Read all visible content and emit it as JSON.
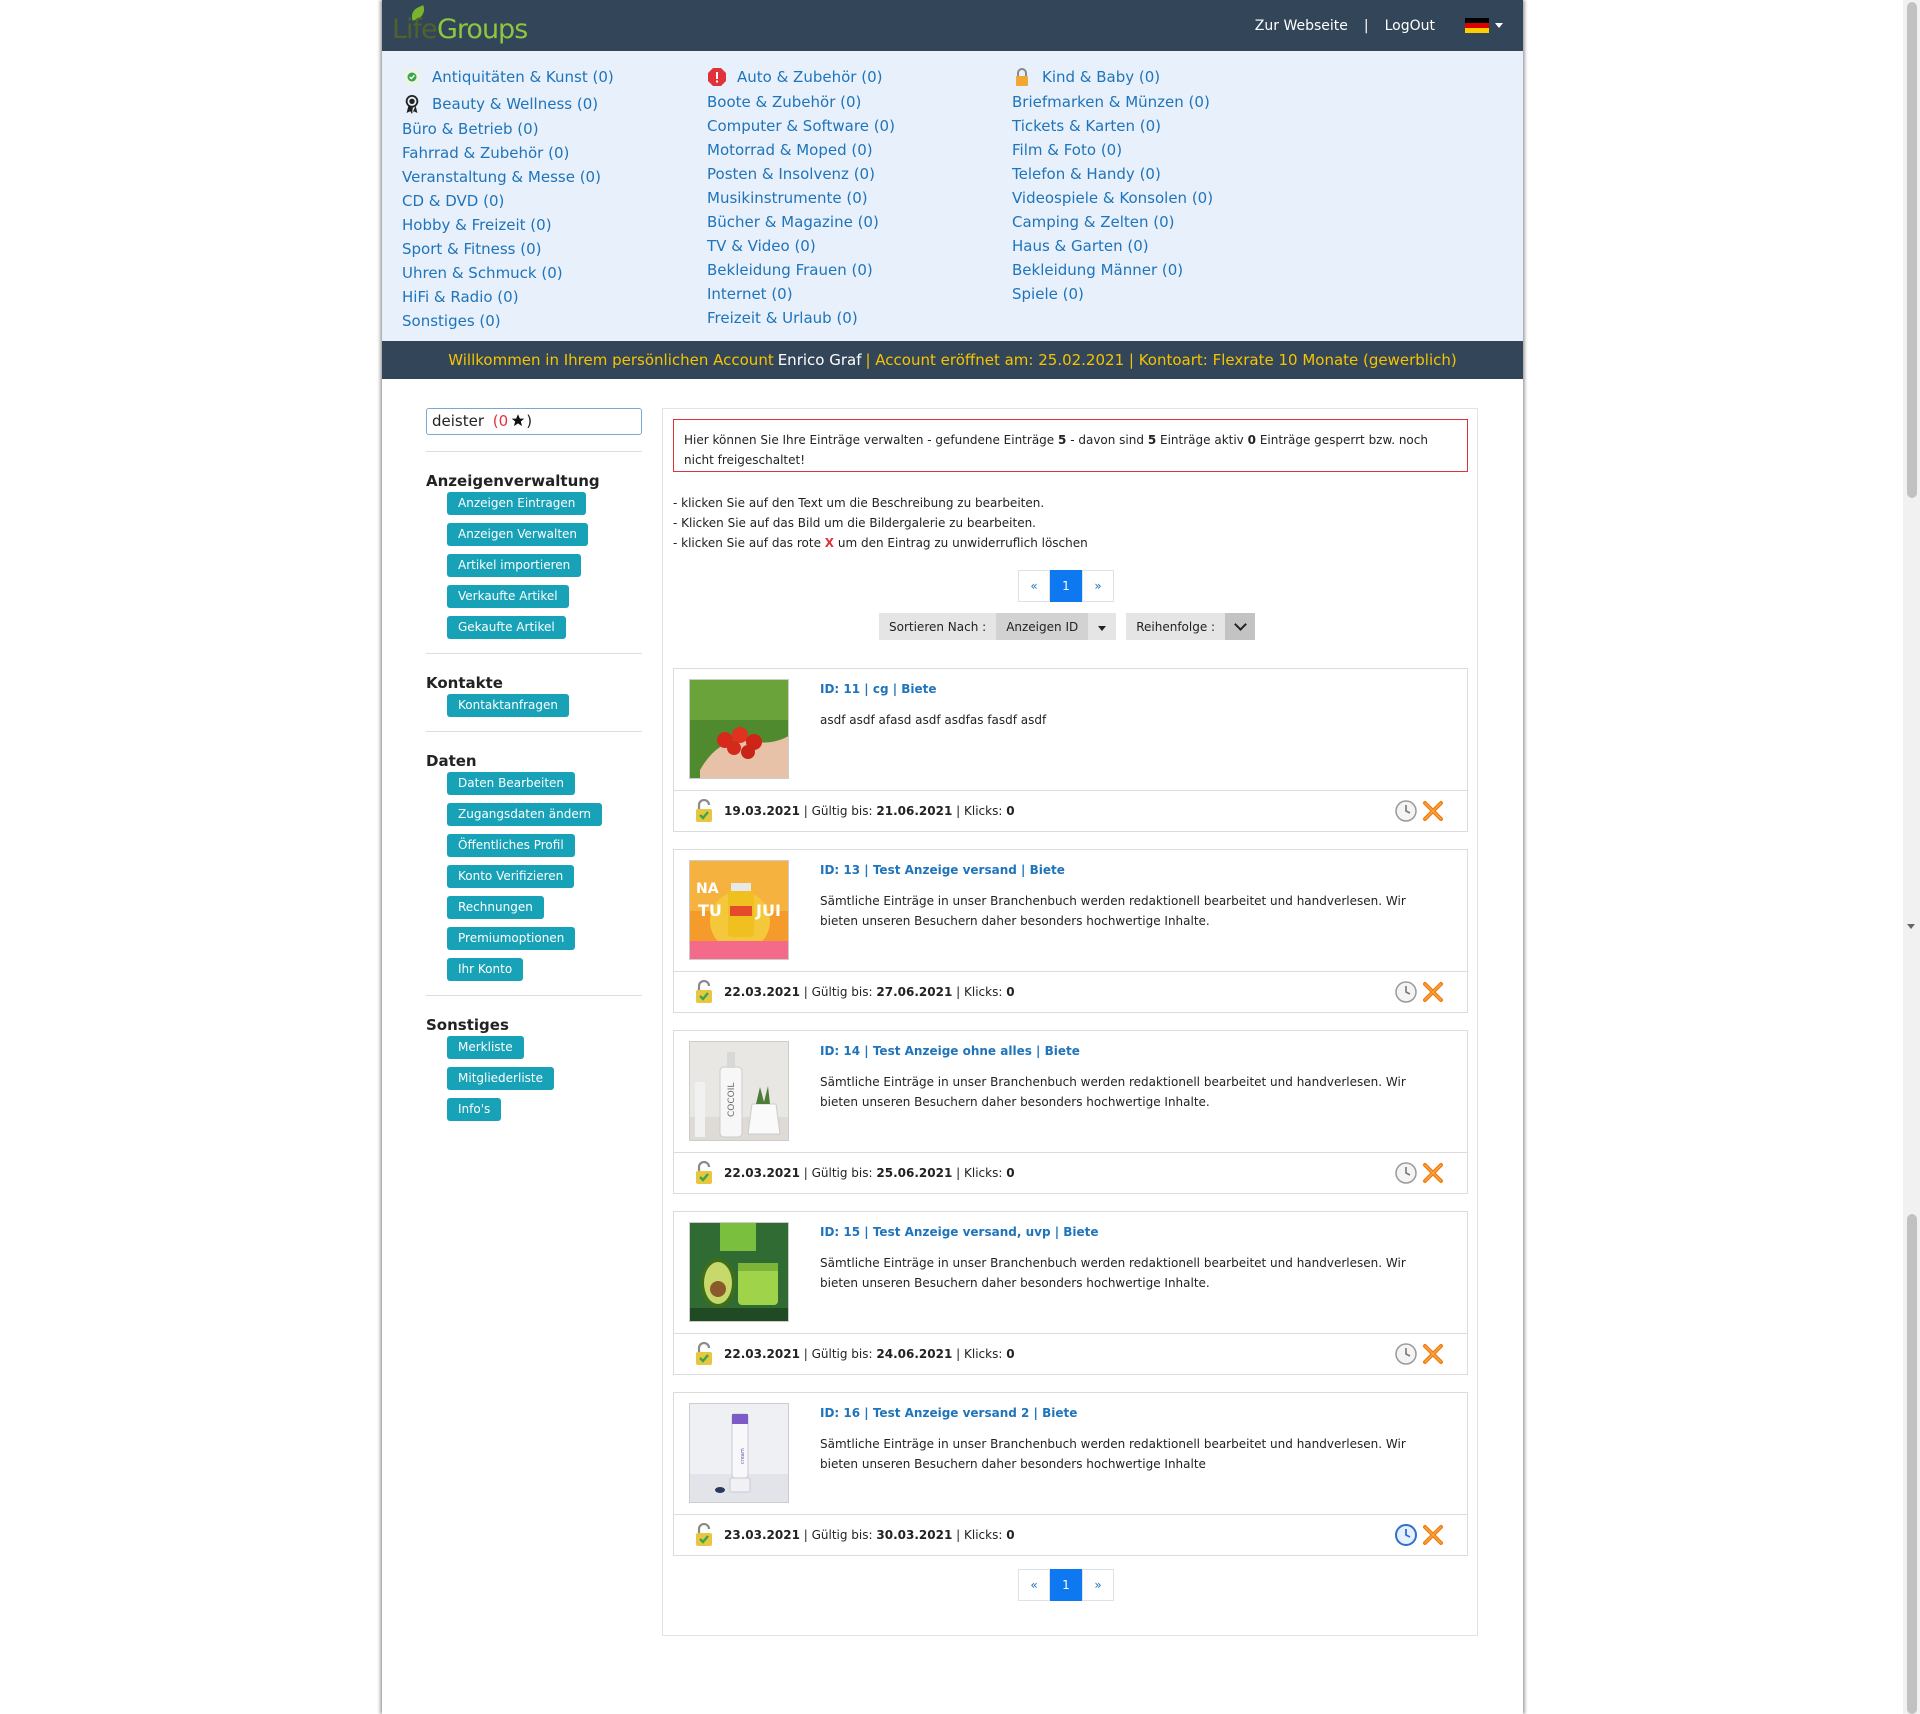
{
  "header": {
    "logo_life": "Life",
    "logo_groups": "Groups",
    "nav_website": "Zur Webseite",
    "nav_separator": "|",
    "nav_logout": "LogOut",
    "language_flag": "de-flag-icon"
  },
  "categories": {
    "col1": [
      {
        "label": "Antiquitäten & Kunst (0)",
        "icon": "check-badge-icon"
      },
      {
        "label": "Beauty & Wellness (0)",
        "icon": "award-ribbon-icon"
      },
      {
        "label": "Büro & Betrieb (0)"
      },
      {
        "label": "Fahrrad & Zubehör (0)"
      },
      {
        "label": "Veranstaltung & Messe (0)"
      },
      {
        "label": "CD & DVD (0)"
      },
      {
        "label": "Hobby & Freizeit (0)"
      },
      {
        "label": "Sport & Fitness (0)"
      },
      {
        "label": "Uhren & Schmuck (0)"
      },
      {
        "label": "HiFi & Radio (0)"
      },
      {
        "label": "Sonstiges (0)"
      }
    ],
    "col2": [
      {
        "label": "Auto & Zubehör (0)",
        "icon": "alert-octagon-icon"
      },
      {
        "label": "Boote & Zubehör (0)"
      },
      {
        "label": "Computer & Software (0)"
      },
      {
        "label": "Motorrad & Moped (0)"
      },
      {
        "label": "Posten & Insolvenz (0)"
      },
      {
        "label": "Musikinstrumente (0)"
      },
      {
        "label": "Bücher & Magazine (0)"
      },
      {
        "label": "TV & Video (0)"
      },
      {
        "label": "Bekleidung Frauen (0)"
      },
      {
        "label": "Internet (0)"
      },
      {
        "label": "Freizeit & Urlaub (0)"
      }
    ],
    "col3": [
      {
        "label": "Kind & Baby (0)",
        "icon": "padlock-icon"
      },
      {
        "label": "Briefmarken & Münzen (0)"
      },
      {
        "label": "Tickets & Karten (0)"
      },
      {
        "label": "Film & Foto (0)"
      },
      {
        "label": "Telefon & Handy (0)"
      },
      {
        "label": "Videospiele & Konsolen (0)"
      },
      {
        "label": "Camping & Zelten (0)"
      },
      {
        "label": "Haus & Garten (0)"
      },
      {
        "label": "Bekleidung Männer (0)"
      },
      {
        "label": "Spiele (0)"
      }
    ]
  },
  "welcome": {
    "prefix": "Willkommen in Ihrem persönlichen Account",
    "name": "Enrico Graf",
    "suffix": "| Account eröffnet am: 25.02.2021 | Kontoart: Flexrate 10 Monate (gewerblich)"
  },
  "sidebar": {
    "user": "deister",
    "user_rating_open": "(0",
    "user_rating_close": ")",
    "sections": [
      {
        "title": "Anzeigenverwaltung",
        "buttons": [
          "Anzeigen Eintragen",
          "Anzeigen Verwalten",
          "Artikel importieren",
          "Verkaufte Artikel",
          "Gekaufte Artikel"
        ]
      },
      {
        "title": "Kontakte",
        "buttons": [
          "Kontaktanfragen"
        ]
      },
      {
        "title": "Daten",
        "buttons": [
          "Daten Bearbeiten",
          "Zugangsdaten ändern",
          "Öffentliches Profil",
          "Konto Verifizieren",
          "Rechnungen",
          "Premiumoptionen",
          "Ihr Konto"
        ]
      },
      {
        "title": "Sonstiges",
        "buttons": [
          "Merkliste",
          "Mitgliederliste",
          "Info's"
        ]
      }
    ]
  },
  "notice": {
    "t1": "Hier können Sie Ihre Einträge verwalten - gefundene Einträge",
    "found": "5",
    "t2": "- davon sind",
    "active": "5",
    "t3": "Einträge aktiv",
    "blocked": "0",
    "t4": "Einträge gesperrt bzw. noch nicht freigeschaltet!"
  },
  "hints": {
    "h1": "- klicken Sie auf den Text um die Beschreibung zu bearbeiten.",
    "h2": "- Klicken Sie auf das Bild um die Bildergalerie zu bearbeiten.",
    "h3a": "- klicken Sie auf das rote",
    "h3x": "X",
    "h3b": "um den Eintrag zu unwiderruflich löschen"
  },
  "pager": {
    "prev": "«",
    "page": "1",
    "next": "»"
  },
  "sort": {
    "label": "Sortieren Nach :",
    "value": "Anzeigen ID",
    "order_label": "Reihenfolge :"
  },
  "meta_labels": {
    "valid": "Gültig bis:",
    "clicks": "Klicks:"
  },
  "listings": [
    {
      "title": "ID: 11 | cg | Biete",
      "desc": "asdf asdf afasd asdf asdfas fasdf asdf",
      "date": "19.03.2021",
      "valid": "21.06.2021",
      "clicks": "0",
      "thumb": "tomatoes-hand",
      "clock": "grey"
    },
    {
      "title": "ID: 13 | Test Anzeige versand | Biete",
      "desc": "Sämtliche Einträge in unser Branchenbuch werden redaktionell bearbeitet und handverlesen. Wir bieten unseren Besuchern daher besonders hochwertige Inhalte.",
      "date": "22.03.2021",
      "valid": "27.06.2021",
      "clicks": "0",
      "thumb": "juice-poster",
      "clock": "grey"
    },
    {
      "title": "ID: 14 | Test Anzeige ohne alles | Biete",
      "desc": "Sämtliche Einträge in unser Branchenbuch werden redaktionell bearbeitet und handverlesen. Wir bieten unseren Besuchern daher besonders hochwertige Inhalte.",
      "date": "22.03.2021",
      "valid": "25.06.2021",
      "clicks": "0",
      "thumb": "cocoil-bottle",
      "clock": "grey"
    },
    {
      "title": "ID: 15 | Test Anzeige versand, uvp | Biete",
      "desc": "Sämtliche Einträge in unser Branchenbuch werden redaktionell bearbeitet und handverlesen. Wir bieten unseren Besuchern daher besonders hochwertige Inhalte.",
      "date": "22.03.2021",
      "valid": "24.06.2021",
      "clicks": "0",
      "thumb": "avocado-cream",
      "clock": "grey"
    },
    {
      "title": "ID: 16 | Test Anzeige versand 2 | Biete",
      "desc": "Sämtliche Einträge in unser Branchenbuch werden redaktionell bearbeitet und handverlesen. Wir bieten unseren Besuchern daher besonders hochwertige Inhalte",
      "date": "23.03.2021",
      "valid": "30.03.2021",
      "clicks": "0",
      "thumb": "cream-tube",
      "clock": "blue"
    }
  ],
  "colors": {
    "header": "#334559",
    "link": "#1f74bb",
    "accent_button": "#17a2b8",
    "welcome_text": "#f5c400",
    "alert_border": "#e0323b"
  }
}
